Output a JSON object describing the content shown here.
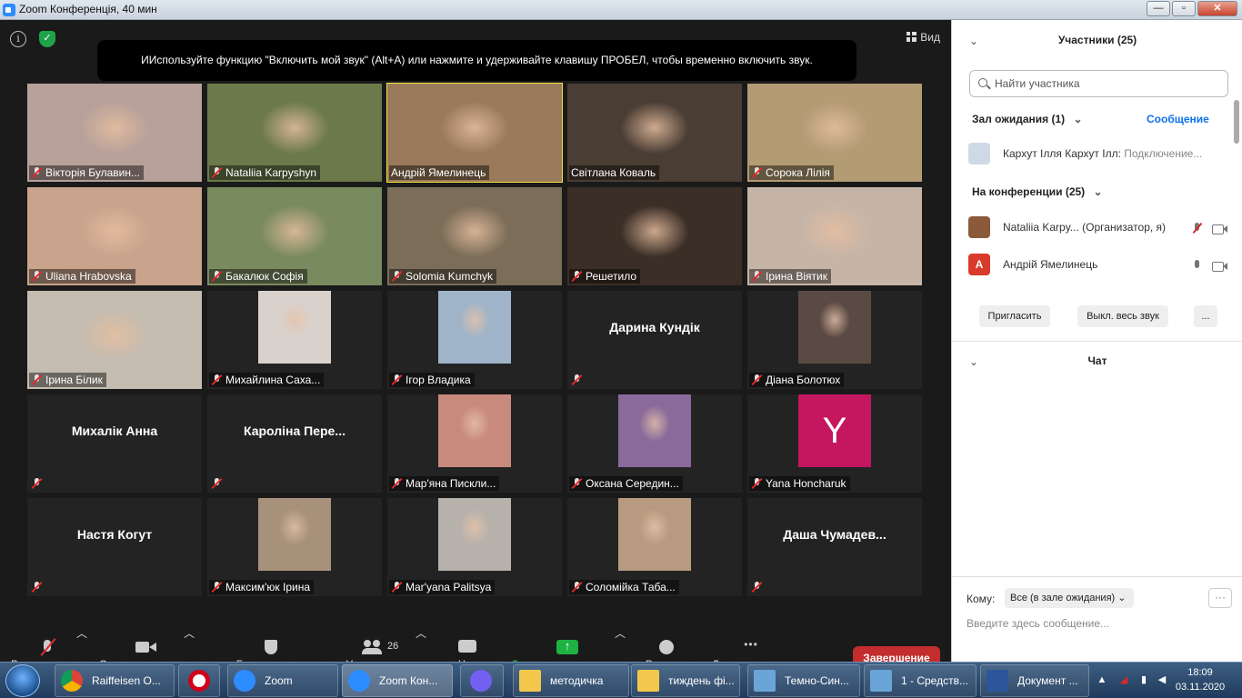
{
  "window": {
    "title": "Zoom Конференція, 40 мин",
    "min": "—",
    "max": "▫",
    "close": "✕"
  },
  "view_label": "Вид",
  "banner": "ИИспользуйте функцию \"Включить мой звук\" (Alt+A) или нажмите и удерживайте клавишу ПРОБЕЛ, чтобы временно включить звук.",
  "tiles": [
    {
      "name": "Вікторія Булавин...",
      "kind": "photo",
      "bg": "#b8a19a"
    },
    {
      "name": "Nataliia Karpyshyn",
      "kind": "photo",
      "bg": "#6c7a4b"
    },
    {
      "name": "Андрій Ямелинець",
      "kind": "photo",
      "bg": "#9a7a5a",
      "active": true,
      "unmuted": true
    },
    {
      "name": "Світлана Коваль",
      "kind": "photo",
      "bg": "#4a3d33",
      "unmuted": true
    },
    {
      "name": "Сорока Лілія",
      "kind": "photo",
      "bg": "#b39b74"
    },
    {
      "name": "Uliana Hrabovska",
      "kind": "photo",
      "bg": "#c9a38c"
    },
    {
      "name": "Бакалюк Софія",
      "kind": "photo",
      "bg": "#7a8a5f"
    },
    {
      "name": "Solomia Kumchyk",
      "kind": "photo",
      "bg": "#7b6d58"
    },
    {
      "name": "Решетило",
      "kind": "photo",
      "bg": "#3b2e26"
    },
    {
      "name": "Ірина Віятик",
      "kind": "photo",
      "bg": "#c6b5a7"
    },
    {
      "name": "Ірина Білик",
      "kind": "photo",
      "bg": "#c4bcb0"
    },
    {
      "name": "Михайлина Саха...",
      "kind": "thumb",
      "bg": "#d9d1cb"
    },
    {
      "name": "Ігор Владика",
      "kind": "thumb",
      "bg": "#9fb4c8"
    },
    {
      "name": "",
      "big": "Дарина Кундік",
      "kind": "text"
    },
    {
      "name": "Діана Болотюх",
      "kind": "thumb",
      "bg": "#5b4a44"
    },
    {
      "name": "",
      "big": "Михалік Анна",
      "kind": "text"
    },
    {
      "name": "",
      "big": "Кароліна Пере...",
      "kind": "text"
    },
    {
      "name": "Мар'яна Пискли...",
      "kind": "thumb",
      "bg": "#c98a7e"
    },
    {
      "name": "Оксана Середин...",
      "kind": "thumb",
      "bg": "#8a6a9a"
    },
    {
      "name": "Yana Honcharuk",
      "kind": "avatar",
      "letter": "Y"
    },
    {
      "name": "",
      "big": "Настя Когут",
      "kind": "text"
    },
    {
      "name": "Максим'юк Ірина",
      "kind": "thumb",
      "bg": "#a8917a"
    },
    {
      "name": "Mar'yana Palitsya",
      "kind": "thumb",
      "bg": "#b7b1ab"
    },
    {
      "name": "Соломійка Таба...",
      "kind": "thumb",
      "bg": "#b79a7f"
    },
    {
      "name": "",
      "big": "Даша  Чумадев...",
      "kind": "text"
    }
  ],
  "toolbar": {
    "mute": "Включить звук",
    "video": "Остановить видео",
    "security": "Безопасность",
    "participants": "Участники",
    "participants_count": "26",
    "chat": "Чат",
    "share": "Демонстрация экрана",
    "reactions": "Реакции",
    "more": "Дополнительно",
    "end": "Завершение"
  },
  "panel": {
    "title": "Участники (25)",
    "search_placeholder": "Найти участника",
    "waiting_title": "Зал ожидания (1)",
    "message_link": "Сообщение",
    "waiting_name": "Кархут Ілля Кархут Ілл:",
    "waiting_status": "Подключение...",
    "in_meeting_title": "На конференции (25)",
    "p1_name": "Nataliia Karpy... (Организатор, я)",
    "p2_name": "Андрій Ямелинець",
    "p2_initial": "А",
    "invite": "Пригласить",
    "mute_all": "Выкл. весь звук",
    "more": "...",
    "chat_title": "Чат",
    "to_label": "Кому:",
    "to_value": "Все (в зале ожидания) ⌄",
    "chat_placeholder": "Введите здесь сообщение..."
  },
  "taskbar": {
    "items": [
      "Raiffeisen O...",
      "Zoom",
      "Zoom Кон...",
      "методичка",
      "тиждень фі...",
      "Темно-Син...",
      "1 - Средств...",
      "Документ ..."
    ],
    "time": "18:09",
    "date": "03.11.2020"
  },
  "colors": {
    "accent": "#0e71eb",
    "end": "#c42d2d",
    "share": "#1fb141",
    "active_speaker": "#f5e43f"
  }
}
